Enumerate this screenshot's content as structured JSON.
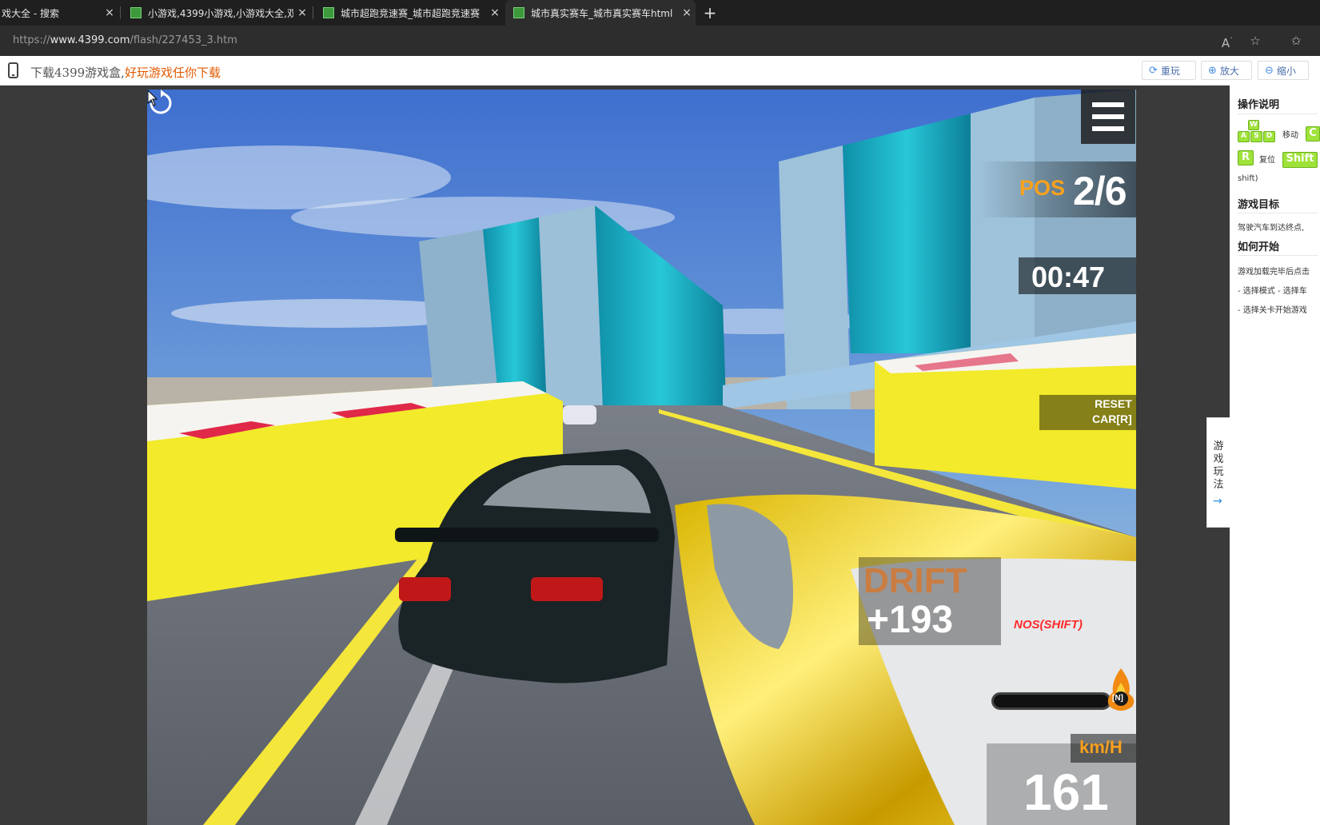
{
  "browser": {
    "tabs": [
      {
        "title": "戏大全 - 搜索",
        "active": false
      },
      {
        "title": "小游戏,4399小游戏,小游戏大全,双",
        "active": false
      },
      {
        "title": "城市超跑竞速赛_城市超跑竞速赛",
        "active": false
      },
      {
        "title": "城市真实赛车_城市真实赛车html",
        "active": true
      }
    ],
    "new_tab_label": "+",
    "close_glyph": "×",
    "url_scheme": "https://",
    "url_host": "www.4399.com",
    "url_path": "/flash/227453_3.htm"
  },
  "site_toolbar": {
    "promo_prefix": "下载4399游戏盒,",
    "promo_highlight": "好玩游戏任你下载",
    "buttons": [
      {
        "label": "重玩",
        "icon": "refresh-icon"
      },
      {
        "label": "放大",
        "icon": "zoom-in-icon"
      },
      {
        "label": "缩小",
        "icon": "zoom-out-icon"
      }
    ]
  },
  "game_hud": {
    "pos_label": "POS",
    "pos_value": "2/6",
    "timer": "00:47",
    "reset_line1": "RESET",
    "reset_line2": "CAR[R]",
    "drift_label": "DRIFT",
    "drift_score": "+193",
    "nos_label": "NOS(SHIFT)",
    "nos_key": "[N]",
    "speed_unit": "km/H",
    "speed_value": "161"
  },
  "instructions_panel": {
    "controls_title": "操作说明",
    "keys_move": [
      "W",
      "A",
      "S",
      "D"
    ],
    "move_label": "移动",
    "key_c": "C",
    "key_r": "R",
    "reset_label": "复位",
    "key_shift": "Shift",
    "shift_text": "shift)",
    "goal_title": "游戏目标",
    "goal_text": "驾驶汽车到达终点,",
    "start_title": "如何开始",
    "start_lines": [
      "游戏加载完毕后点击",
      "- 选择模式 - 选择车",
      "- 选择关卡开始游戏"
    ]
  },
  "side_tab": {
    "label": "游戏玩法",
    "arrow": "→"
  },
  "colors": {
    "hud_orange": "#f7a11d",
    "nos_red": "#ff2a2a",
    "key_green": "#9fe23a",
    "promo_orange": "#e05a00"
  }
}
